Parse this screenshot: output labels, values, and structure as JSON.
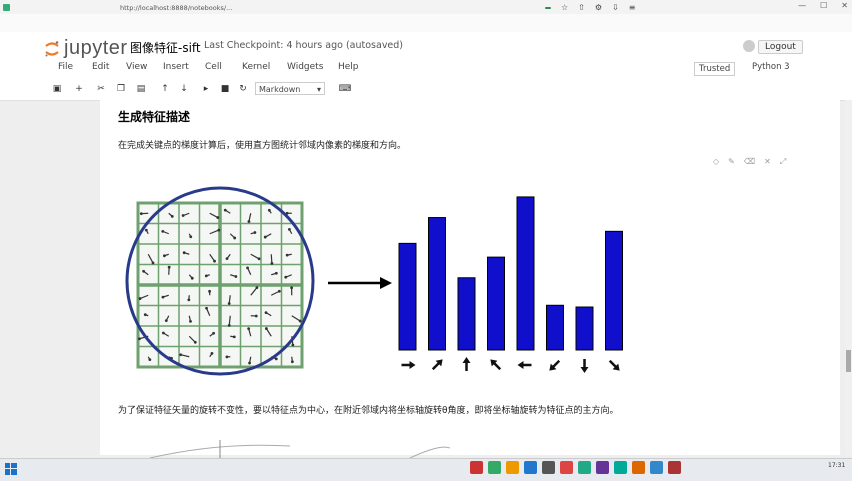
{
  "browser": {
    "tab_label": "",
    "address": "http://localhost:8888/notebooks/...",
    "sync_badge": "",
    "window_controls": [
      "—",
      "☐",
      "✕"
    ]
  },
  "jupyter": {
    "logo_text": "jupyter",
    "notebook_title": "图像特征-sift",
    "checkpoint": "Last Checkpoint: 4 hours ago (autosaved)",
    "logout": "Logout",
    "trusted": "Trusted",
    "kernel": "Python 3",
    "menu": [
      "File",
      "Edit",
      "View",
      "Insert",
      "Cell",
      "Kernel",
      "Widgets",
      "Help"
    ],
    "cell_type": "Markdown"
  },
  "cell": {
    "heading": "生成特征描述",
    "intro": "在完成关键点的梯度计算后，使用直方图统计邻域内像素的梯度和方向。",
    "footer": "为了保证特征矢量的旋转不变性，要以特征点为中心，在附近邻域内将坐标轴旋转θ角度，即将坐标轴旋转为特征点的主方向。"
  },
  "figure": {
    "histogram_bar_heights": [
      0.62,
      0.77,
      0.42,
      0.54,
      0.89,
      0.26,
      0.25,
      0.69
    ],
    "histogram_directions_deg": [
      0,
      45,
      90,
      135,
      180,
      225,
      270,
      315
    ],
    "bar_color": "#1010cc",
    "circle_color": "#2a3a8a",
    "grid_color": "#6fa06f"
  },
  "taskbar": {
    "search_text": "",
    "notice_text": "",
    "clock": "17:31"
  }
}
